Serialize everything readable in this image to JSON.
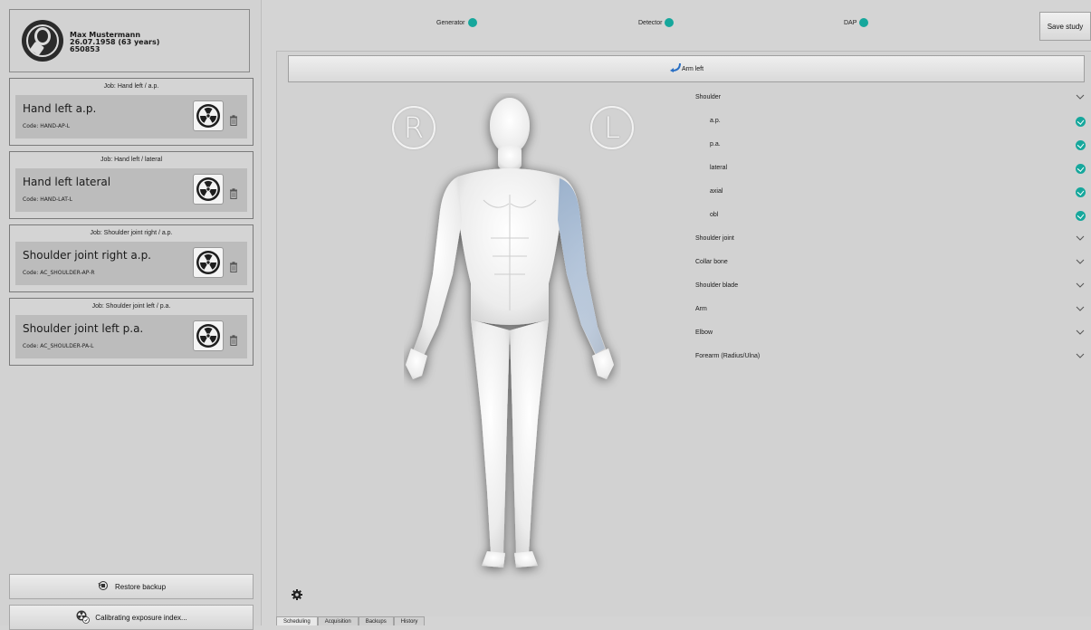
{
  "patient": {
    "name": "Max Mustermann",
    "dob": "26.07.1958 (63 years)",
    "id": "650853"
  },
  "jobs": [
    {
      "title": "Job: Hand left / a.p.",
      "exam": "Hand left a.p.",
      "code": "Code: HAND-AP-L"
    },
    {
      "title": "Job: Hand left / lateral",
      "exam": "Hand left lateral",
      "code": "Code: HAND-LAT-L"
    },
    {
      "title": "Job: Shoulder joint right / a.p.",
      "exam": "Shoulder joint right a.p.",
      "code": "Code: AC_SHOULDER-AP-R"
    },
    {
      "title": "Job: Shoulder joint left / p.a.",
      "exam": "Shoulder joint left p.a.",
      "code": "Code: AC_SHOULDER-PA-L"
    }
  ],
  "buttons": {
    "restore_backup": "Restore backup",
    "calibrating": "Calibrating exposure index...",
    "save_study": "Save study"
  },
  "status": {
    "generator": "Generator",
    "detector": "Detector",
    "dap": "DAP",
    "color": "#16a79c"
  },
  "body_part": "Arm left",
  "markers": {
    "right": "R",
    "left": "L"
  },
  "tree": [
    {
      "label": "Shoulder",
      "level": 0,
      "state": "expanded"
    },
    {
      "label": "a.p.",
      "level": 1,
      "state": "done"
    },
    {
      "label": "p.a.",
      "level": 1,
      "state": "done"
    },
    {
      "label": "lateral",
      "level": 1,
      "state": "done"
    },
    {
      "label": "axial",
      "level": 1,
      "state": "done"
    },
    {
      "label": "obl",
      "level": 1,
      "state": "done"
    },
    {
      "label": "Shoulder joint",
      "level": 0,
      "state": "collapsed"
    },
    {
      "label": "Collar bone",
      "level": 0,
      "state": "collapsed"
    },
    {
      "label": "Shoulder blade",
      "level": 0,
      "state": "collapsed"
    },
    {
      "label": "Arm",
      "level": 0,
      "state": "collapsed"
    },
    {
      "label": "Elbow",
      "level": 0,
      "state": "collapsed"
    },
    {
      "label": "Forearm (Radius/Ulna)",
      "level": 0,
      "state": "collapsed"
    }
  ],
  "tabs": [
    {
      "label": "Scheduling",
      "active": true
    },
    {
      "label": "Acquisition",
      "active": false
    },
    {
      "label": "Backups",
      "active": false
    },
    {
      "label": "History",
      "active": false
    }
  ],
  "icons": {
    "avatar": "person-avatar-icon",
    "radiation": "radiation-icon",
    "trash": "trash-icon",
    "settings": "gear-icon",
    "arrow": "curved-arrow-icon",
    "restore": "restore-icon",
    "calibrate": "calibrate-icon"
  }
}
